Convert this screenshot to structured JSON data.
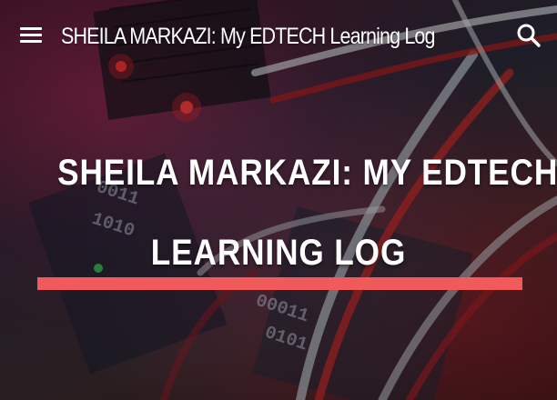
{
  "header": {
    "site_title": "SHEILA MARKAZI: My EDTECH Learning Log",
    "menu_icon": "hamburger-menu-icon",
    "search_icon": "search-icon"
  },
  "hero": {
    "heading_line_1": "SHEILA MARKAZI: MY EDTECH",
    "heading_line_2": "LEARNING LOG",
    "background_image": "circuit-wires-photo"
  },
  "colors": {
    "accent": "#f05a5a",
    "text": "#ffffff"
  }
}
